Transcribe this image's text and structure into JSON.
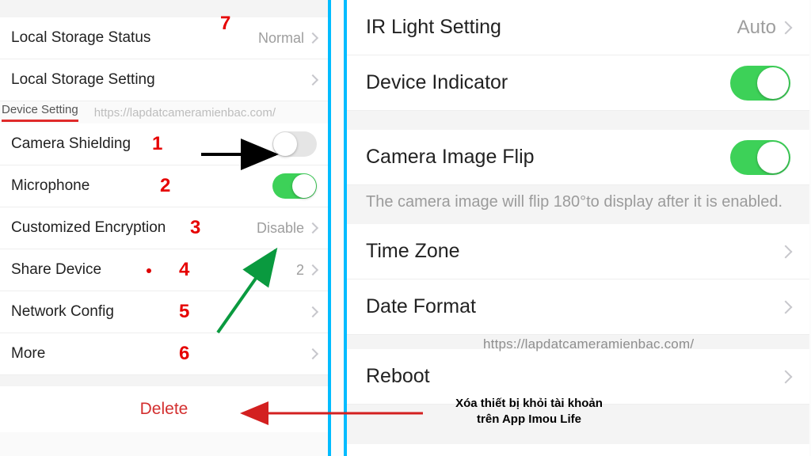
{
  "left": {
    "storage_status_label": "Local Storage Status",
    "storage_status_value": "Normal",
    "storage_setting_label": "Local Storage Setting",
    "tab_label": "Device Setting",
    "watermark": "https://lapdatcameramienbac.com/",
    "camera_shielding_label": "Camera Shielding",
    "microphone_label": "Microphone",
    "encryption_label": "Customized Encryption",
    "encryption_value": "Disable",
    "share_label": "Share Device",
    "share_value": "2",
    "network_label": "Network Config",
    "more_label": "More",
    "delete_label": "Delete",
    "nums": {
      "n1": "1",
      "n2": "2",
      "n3": "3",
      "n4": "4",
      "n5": "5",
      "n6": "6",
      "n7": "7"
    }
  },
  "right": {
    "ir_label": "IR Light Setting",
    "ir_value": "Auto",
    "indicator_label": "Device Indicator",
    "flip_label": "Camera Image Flip",
    "flip_hint": "The camera image will flip 180°to display after it is enabled.",
    "tz_label": "Time Zone",
    "date_label": "Date Format",
    "reboot_label": "Reboot",
    "watermark": "https://lapdatcameramienbac.com/"
  },
  "caption": "Xóa thiết bị khỏi tài khoản\ntrên App Imou Life"
}
